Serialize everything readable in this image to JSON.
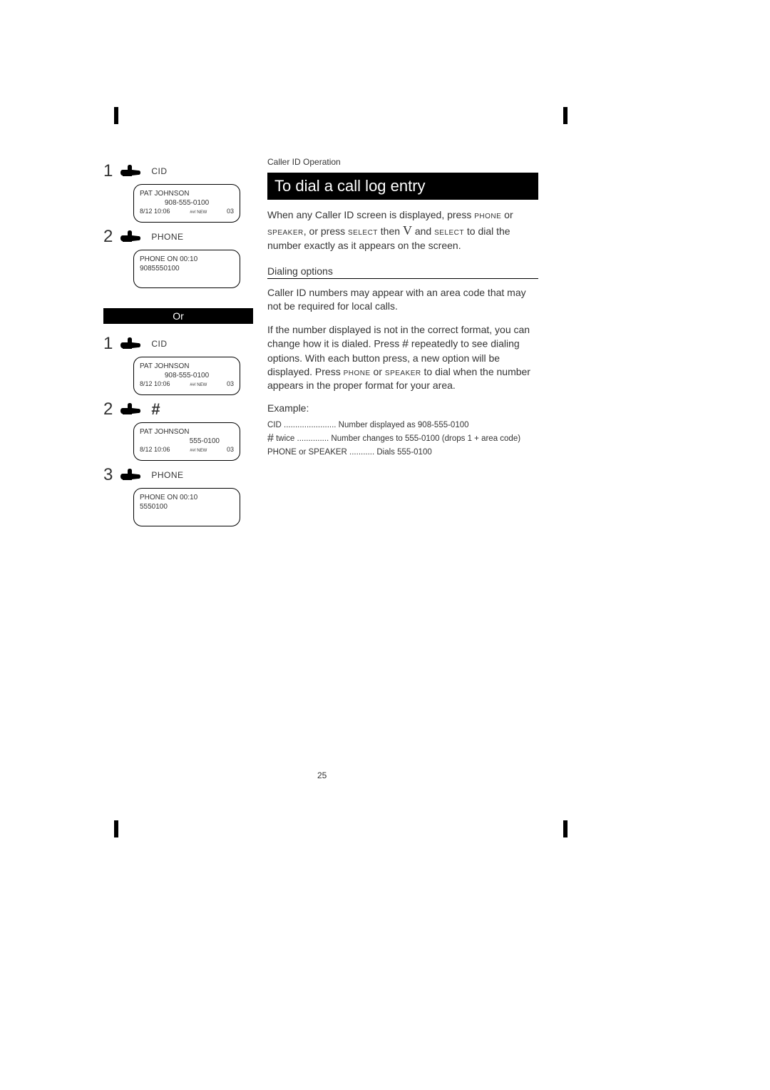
{
  "crop_marks": true,
  "page_number": "25",
  "sidebar": {
    "seq_a": {
      "step1": {
        "num": "1",
        "label": "CID"
      },
      "lcd1": {
        "l1": "PAT JOHNSON",
        "l2": "908-555-0100",
        "l3a": "8/12 10:06",
        "l3b": "##/ NEW",
        "l3c": "03"
      },
      "step2": {
        "num": "2",
        "label": "PHONE"
      },
      "lcd2": {
        "l1": "PHONE ON  00:10",
        "l2": "9085550100"
      }
    },
    "or_label": "Or",
    "seq_b": {
      "step1": {
        "num": "1",
        "label": "CID"
      },
      "lcd1": {
        "l1": "PAT JOHNSON",
        "l2": "908-555-0100",
        "l3a": "8/12 10:06",
        "l3b": "##/ NEW",
        "l3c": "03"
      },
      "step2": {
        "num": "2",
        "label": "#"
      },
      "lcd2": {
        "l1": "PAT JOHNSON",
        "l2": "555-0100",
        "l3a": "8/12 10:06",
        "l3b": "##/ NEW",
        "l3c": "03"
      },
      "step3": {
        "num": "3",
        "label": "PHONE"
      },
      "lcd3": {
        "l1": "PHONE ON  00:10",
        "l2": "5550100"
      }
    }
  },
  "main": {
    "kicker": "Caller ID Operation",
    "title": "To dial a call log entry",
    "para1_a": "When any Caller ID screen is displayed, press ",
    "k_phone": "PHONE",
    "para1_b": " or ",
    "k_speaker": "SPEAKER",
    "para1_c": ", or press ",
    "k_select": "SELECT",
    "para1_d": " then ",
    "k_V": "V",
    "para1_e": " and ",
    "para1_f": " to dial the number exactly as it appears on the screen.",
    "subhead": "Dialing options",
    "para2": "Caller ID numbers may appear with an area code that may not be required for local calls.",
    "para3_a": "If the number displayed is not in the correct format, you can change how it is dialed. Press ",
    "k_hash": "#",
    "para3_b": " repeatedly to see dialing options. With each button press, a new option will be displayed. Press ",
    "para3_c": " or ",
    "para3_d": " to dial when the number appears in the proper format for your area.",
    "example_label": "Example:",
    "ex1": "CID ....................... Number displayed as 908-555-0100",
    "ex2_a": "#",
    "ex2_b": "   twice .............. Number changes to 555-0100 (drops  1  + area code)",
    "ex3": "PHONE  or SPEAKER ........... Dials 555-0100"
  }
}
